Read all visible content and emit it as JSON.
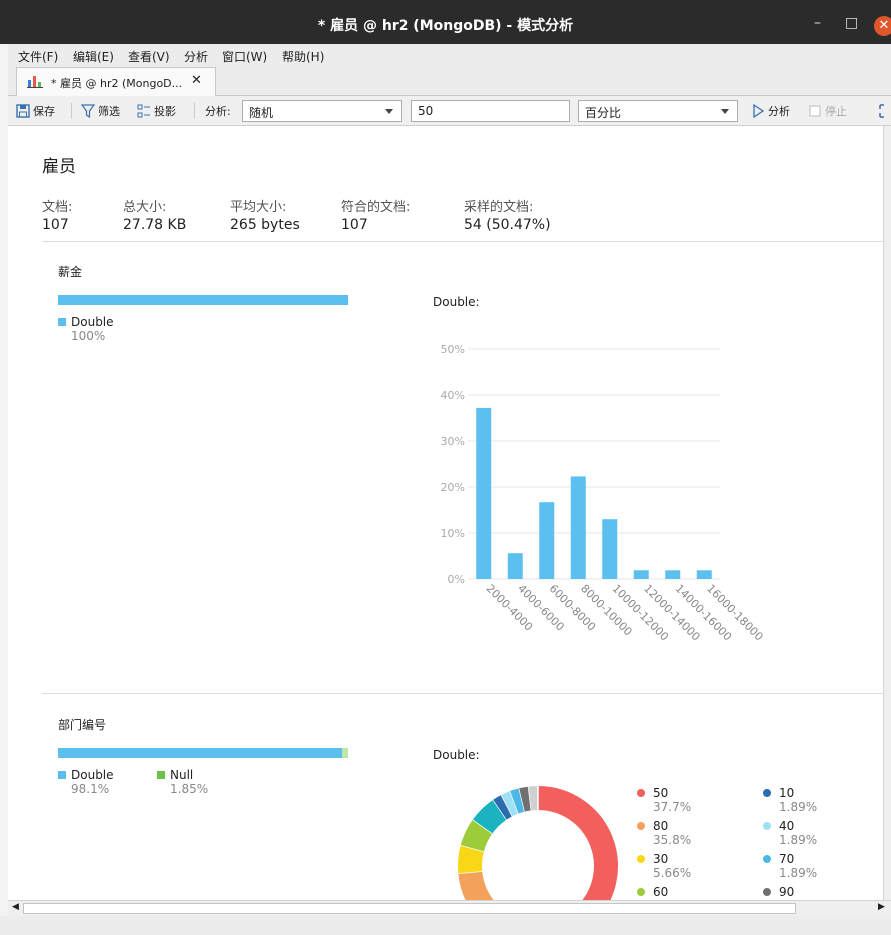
{
  "window": {
    "title": "* 雇员 @ hr2 (MongoDB) - 模式分析",
    "minimize": "–",
    "maximize": "□",
    "close": "✕"
  },
  "menu": [
    "文件(F)",
    "编辑(E)",
    "查看(V)",
    "分析",
    "窗口(W)",
    "帮助(H)"
  ],
  "tab": {
    "label": "* 雇员 @ hr2 (MongoD...",
    "close": "✕"
  },
  "toolbar": {
    "save": "保存",
    "filter": "筛选",
    "project": "投影",
    "analyze_label": "分析:",
    "mode": "随机",
    "sample_count": "50",
    "unit": "百分比",
    "run": "分析",
    "stop": "停止"
  },
  "collection": {
    "name": "雇员",
    "stats": [
      {
        "label": "文档:",
        "value": "107"
      },
      {
        "label": "总大小:",
        "value": "27.78 KB"
      },
      {
        "label": "平均大小:",
        "value": "265 bytes"
      },
      {
        "label": "符合的文档:",
        "value": "107"
      },
      {
        "label": "采样的文档:",
        "value": "54 (50.47%)"
      }
    ]
  },
  "fields": [
    {
      "name": "薪金",
      "types": [
        {
          "name": "Double",
          "pct": "100%",
          "fraction": 1.0,
          "color": "#5bc0f0"
        }
      ],
      "chart_title": "Double:"
    },
    {
      "name": "部门编号",
      "types": [
        {
          "name": "Double",
          "pct": "98.1%",
          "fraction": 0.981,
          "color": "#5bc0f0"
        },
        {
          "name": "Null",
          "pct": "1.85%",
          "fraction": 0.0185,
          "color": "#6cc24a"
        }
      ],
      "chart_title": "Double:"
    }
  ],
  "chart_data": [
    {
      "type": "bar",
      "categories": [
        "2000-4000",
        "4000-6000",
        "6000-8000",
        "8000-10000",
        "10000-12000",
        "12000-14000",
        "14000-16000",
        "16000-18000"
      ],
      "values": [
        37.2,
        5.6,
        16.7,
        22.3,
        13.0,
        1.9,
        1.9,
        1.9
      ],
      "y_ticks": [
        "0%",
        "10%",
        "20%",
        "30%",
        "40%",
        "50%"
      ],
      "ylim": [
        0,
        50
      ],
      "color": "#5bc0f0",
      "grid": true
    },
    {
      "type": "pie",
      "donut": true,
      "slices": [
        {
          "label": "50",
          "pct": "37.7%",
          "value": 37.7,
          "color": "#f25f5c"
        },
        {
          "label": "80",
          "pct": "35.8%",
          "value": 35.8,
          "color": "#f4a25b"
        },
        {
          "label": "30",
          "pct": "5.66%",
          "value": 5.66,
          "color": "#f7d716"
        },
        {
          "label": "60",
          "pct": "",
          "value": 5.66,
          "color": "#9ccc3a"
        },
        {
          "label": "",
          "pct": "",
          "value": 5.66,
          "color": "#1bb3c0"
        },
        {
          "label": "10",
          "pct": "1.89%",
          "value": 1.89,
          "color": "#2b6cb0"
        },
        {
          "label": "40",
          "pct": "1.89%",
          "value": 1.89,
          "color": "#9fe0f5"
        },
        {
          "label": "70",
          "pct": "1.89%",
          "value": 1.89,
          "color": "#4cb8e8"
        },
        {
          "label": "90",
          "pct": "",
          "value": 1.89,
          "color": "#707070"
        },
        {
          "label": "",
          "pct": "",
          "value": 1.89,
          "color": "#d0d0d0"
        }
      ]
    }
  ]
}
